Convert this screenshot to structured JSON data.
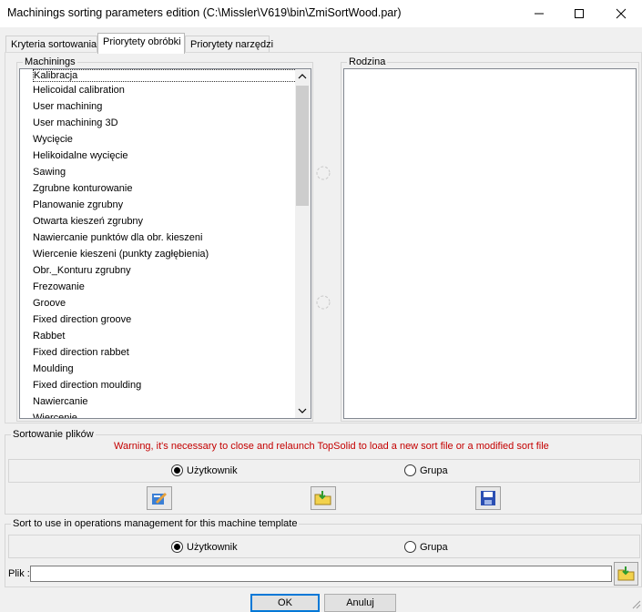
{
  "window": {
    "title": "Machinings sorting parameters edition (C:\\Missler\\V619\\bin\\ZmiSortWood.par)"
  },
  "tabs": [
    {
      "label": "Kryteria sortowania"
    },
    {
      "label": "Priorytety obróbki"
    },
    {
      "label": "Priorytety narzędzi"
    }
  ],
  "machinings": {
    "label": "Machinings",
    "items": [
      "Kalibracja",
      "Helicoidal calibration",
      "User machining",
      "User machining 3D",
      "Wycięcie",
      "Helikoidalne wycięcie",
      "Sawing",
      "Zgrubne konturowanie",
      "Planowanie zgrubny",
      "Otwarta kieszeń zgrubny",
      "Nawiercanie punktów dla obr. kieszeni",
      "Wiercenie kieszeni (punkty zagłębienia)",
      "Obr._Konturu zgrubny",
      "Frezowanie",
      "Groove",
      "Fixed direction groove",
      "Rabbet",
      "Fixed direction rabbet",
      "Moulding",
      "Fixed direction moulding",
      "Nawiercanie",
      "Wiercenie"
    ]
  },
  "family": {
    "label": "Rodzina"
  },
  "sort_files": {
    "label": "Sortowanie plików",
    "warning": "Warning, it's necessary to close and relaunch TopSolid to load a new sort file or a modified sort file",
    "option_user": "Użytkownik",
    "option_group": "Grupa",
    "selected": "Użytkownik"
  },
  "machine_template": {
    "label": "Sort to use in operations management for this machine template",
    "option_user": "Użytkownik",
    "option_group": "Grupa",
    "selected": "Użytkownik",
    "file_label": "Plik :",
    "file_value": ""
  },
  "buttons": {
    "ok": "OK",
    "cancel": "Anuluj"
  },
  "colors": {
    "warning": "#c40000",
    "accent": "#0078d7"
  }
}
